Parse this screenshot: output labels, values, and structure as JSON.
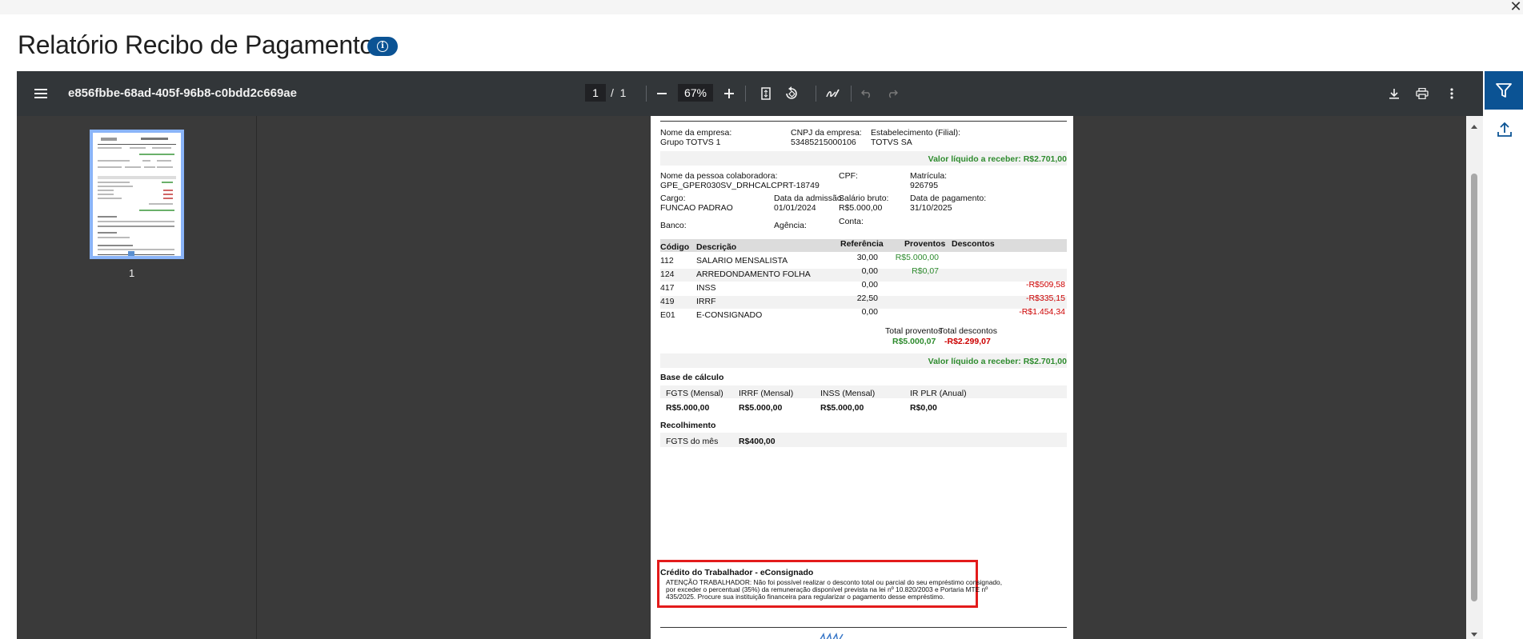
{
  "window": {
    "close_glyph": "✕"
  },
  "header": {
    "title": "Relatório Recibo de Pagamento",
    "info_icon": "info-icon"
  },
  "viewer": {
    "file_name": "e856fbbe-68ad-405f-96b8-c0bdd2c669ae",
    "current_page": "1",
    "page_separator": "/",
    "total_pages": "1",
    "zoom": "67%",
    "thumbnail_label": "1"
  },
  "doc": {
    "empresa_label": "Nome da empresa:",
    "empresa_value": "Grupo TOTVS 1",
    "cnpj_label": "CNPJ da empresa:",
    "cnpj_value": "53485215000106",
    "estab_label": "Estabelecimento (Filial):",
    "estab_value": "TOTVS SA",
    "liquido_top": "Valor líquido a receber: R$2.701,00",
    "pessoa_label": "Nome da pessoa colaboradora:",
    "pessoa_value": "GPE_GPER030SV_DRHCALCPRT-18749",
    "cpf_label": "CPF:",
    "matricula_label": "Matrícula:",
    "matricula_value": "926795",
    "cargo_label": "Cargo:",
    "cargo_value": "FUNCAO PADRAO",
    "admissao_label": "Data da admissão:",
    "admissao_value": "01/01/2024",
    "salario_label": "Salário bruto:",
    "salario_value": "R$5.000,00",
    "pagamento_label": "Data de pagamento:",
    "pagamento_value": "31/10/2025",
    "banco_label": "Banco:",
    "agencia_label": "Agência:",
    "conta_label": "Conta:",
    "table_headers": {
      "codigo": "Código",
      "descricao": "Descrição",
      "referencia": "Referência",
      "proventos": "Proventos",
      "descontos": "Descontos"
    },
    "rows": [
      {
        "codigo": "112",
        "descricao": "SALARIO MENSALISTA",
        "referencia": "30,00",
        "proventos": "R$5.000,00",
        "descontos": ""
      },
      {
        "codigo": "124",
        "descricao": "ARREDONDAMENTO FOLHA",
        "referencia": "0,00",
        "proventos": "R$0,07",
        "descontos": ""
      },
      {
        "codigo": "417",
        "descricao": "INSS",
        "referencia": "0,00",
        "proventos": "",
        "descontos": "-R$509,58"
      },
      {
        "codigo": "419",
        "descricao": "IRRF",
        "referencia": "22,50",
        "proventos": "",
        "descontos": "-R$335,15"
      },
      {
        "codigo": "E01",
        "descricao": "E-CONSIGNADO",
        "referencia": "0,00",
        "proventos": "",
        "descontos": "-R$1.454,34"
      }
    ],
    "total_proventos_label": "Total proventos",
    "total_descontos_label": "Total descontos",
    "total_proventos_value": "R$5.000,07",
    "total_descontos_value": "-R$2.299,07",
    "liquido_bottom": "Valor líquido a receber: R$2.701,00",
    "base_title": "Base de cálculo",
    "base_headers": [
      "FGTS (Mensal)",
      "IRRF (Mensal)",
      "INSS (Mensal)",
      "IR PLR (Anual)"
    ],
    "base_values": [
      "R$5.000,00",
      "R$5.000,00",
      "R$5.000,00",
      "R$0,00"
    ],
    "recolhimento_title": "Recolhimento",
    "fgts_mes_label": "FGTS do mês",
    "fgts_mes_value": "R$400,00",
    "credito_title": "Crédito do Trabalhador - eConsignado",
    "credito_line1": "ATENÇÃO TRABALHADOR: Não foi possível realizar o desconto total ou parcial do seu empréstimo consignado,",
    "credito_line2": "por exceder o percentual (35%) da remuneração disponível prevista na lei nº 10.820/2003 e Portaria MTE nº",
    "credito_line3": "435/2025. Procure sua instituição financeira para regularizar o pagamento desse empréstimo."
  },
  "colors": {
    "accent": "#0b5394",
    "toolbar": "#323639",
    "viewer_bg": "#3a3a3a",
    "positive": "#2e8b2e",
    "negative": "#cc0000",
    "highlight": "#e31b1b"
  }
}
